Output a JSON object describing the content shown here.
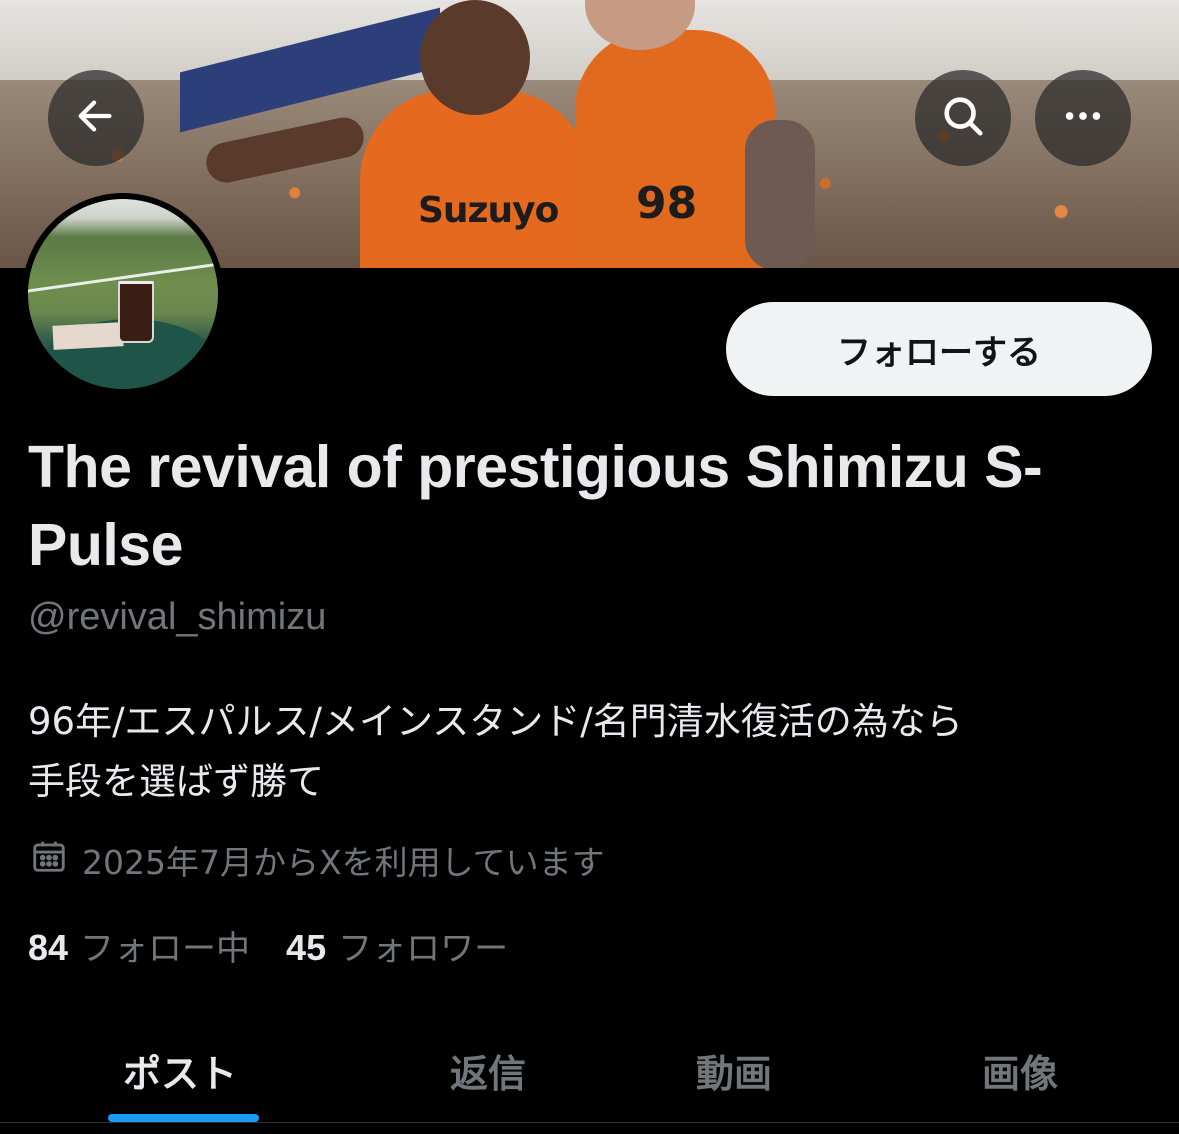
{
  "header": {
    "back_icon": "arrow-left-icon",
    "search_icon": "search-icon",
    "more_icon": "more-horizontal-icon"
  },
  "profile": {
    "display_name": "The revival of prestigious Shimizu S-Pulse",
    "handle": "@revival_shimizu",
    "follow_label": "フォローする",
    "bio_line1": "96年/エスパルス/メインスタンド/名門清水復活の為なら",
    "bio_line2": "手段を選ばず勝て",
    "joined": "2025年7月からXを利用しています",
    "following_count": "84",
    "following_label": "フォロー中",
    "followers_count": "45",
    "followers_label": "フォロワー"
  },
  "banner": {
    "shirt_text": "Suzuyo",
    "shirt_number": "98"
  },
  "tabs": [
    {
      "label": "ポスト",
      "active": true
    },
    {
      "label": "返信",
      "active": false
    },
    {
      "label": "動画",
      "active": false
    },
    {
      "label": "画像",
      "active": false
    }
  ],
  "colors": {
    "background": "#000000",
    "text_primary": "#e7e9ea",
    "text_secondary": "#71767b",
    "accent": "#1d9bf0",
    "follow_bg": "#eff3f4"
  }
}
